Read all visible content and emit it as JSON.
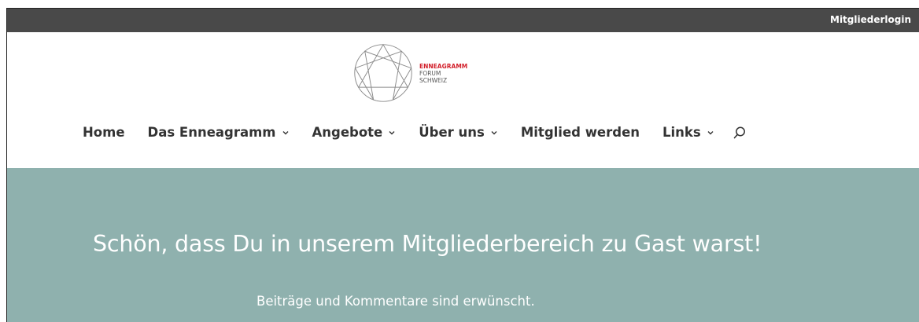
{
  "topbar": {
    "login_label": "Mitgliederlogin"
  },
  "logo": {
    "line1": "ENNEAGRAMM",
    "line2": "FORUM",
    "line3": "SCHWEIZ",
    "icon": "enneagram-symbol"
  },
  "nav": {
    "items": [
      {
        "label": "Home",
        "has_dropdown": false
      },
      {
        "label": "Das Enneagramm",
        "has_dropdown": true
      },
      {
        "label": "Angebote",
        "has_dropdown": true
      },
      {
        "label": "Über uns",
        "has_dropdown": true
      },
      {
        "label": "Mitglied werden",
        "has_dropdown": false
      },
      {
        "label": "Links",
        "has_dropdown": true
      }
    ],
    "search_icon": "search-icon"
  },
  "hero": {
    "heading": "Schön, dass Du in unserem Mitgliederbereich zu Gast warst!",
    "subtext": "Beiträge und Kommentare sind erwünscht."
  },
  "colors": {
    "topbar_bg": "#494949",
    "hero_bg": "#8fb1ae",
    "brand_red": "#d21f2a",
    "nav_text": "#333333"
  }
}
